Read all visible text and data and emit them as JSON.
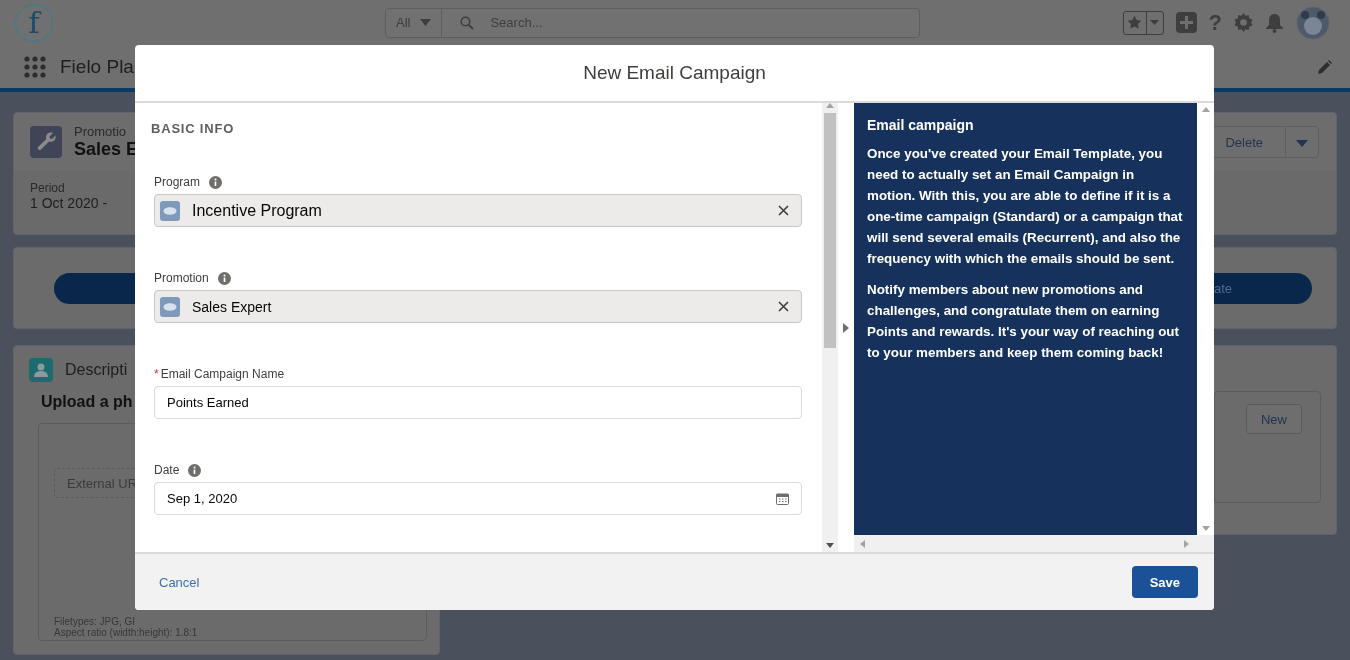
{
  "header": {
    "logo_text": "f",
    "search_scope": "All",
    "search_placeholder": "Search...",
    "help_glyph": "?"
  },
  "nav": {
    "app_name": "Fielo Pla"
  },
  "record": {
    "object_label": "Promotio",
    "title": "Sales E",
    "actions": [
      "Delete"
    ],
    "period_label": "Period",
    "period_value": "1 Oct 2020 -"
  },
  "path": {
    "button_label": "ate"
  },
  "description_card": {
    "title": "Descripti",
    "upload_heading": "Upload a ph",
    "url_placeholder": "External UR",
    "filetypes": "Filetypes: JPG, GI",
    "aspect_ratio": "Aspect ratio (width:height): 1.8:1"
  },
  "related_card": {
    "button": "New"
  },
  "modal": {
    "title": "New Email Campaign",
    "section": "BASIC INFO",
    "fields": [
      {
        "kind": "lookup",
        "label": "Program",
        "info": true,
        "value": "Incentive Program"
      },
      {
        "kind": "lookup",
        "label": "Promotion",
        "info": true,
        "value": "Sales Expert"
      },
      {
        "kind": "text",
        "label": "Email Campaign Name",
        "required_mark": "*",
        "info": false,
        "value": "Points Earned"
      },
      {
        "kind": "date",
        "label": "Date",
        "info": true,
        "value": "Sep 1, 2020"
      }
    ],
    "help": {
      "title": "Email campaign",
      "paragraphs": [
        "Once you've created your Email Template, you need to actually set an Email Campaign in motion. With this, you are able to define if it is a one-time campaign (Standard) or a campaign that will send several emails (Recurrent), and also the frequency with which the emails should be sent.",
        "Notify members about new promotions and challenges, and congratulate them on earning Points and rewards. It's your way of reaching out to your members and keep them coming back!"
      ]
    },
    "footer": {
      "cancel": "Cancel",
      "save": "Save"
    }
  }
}
